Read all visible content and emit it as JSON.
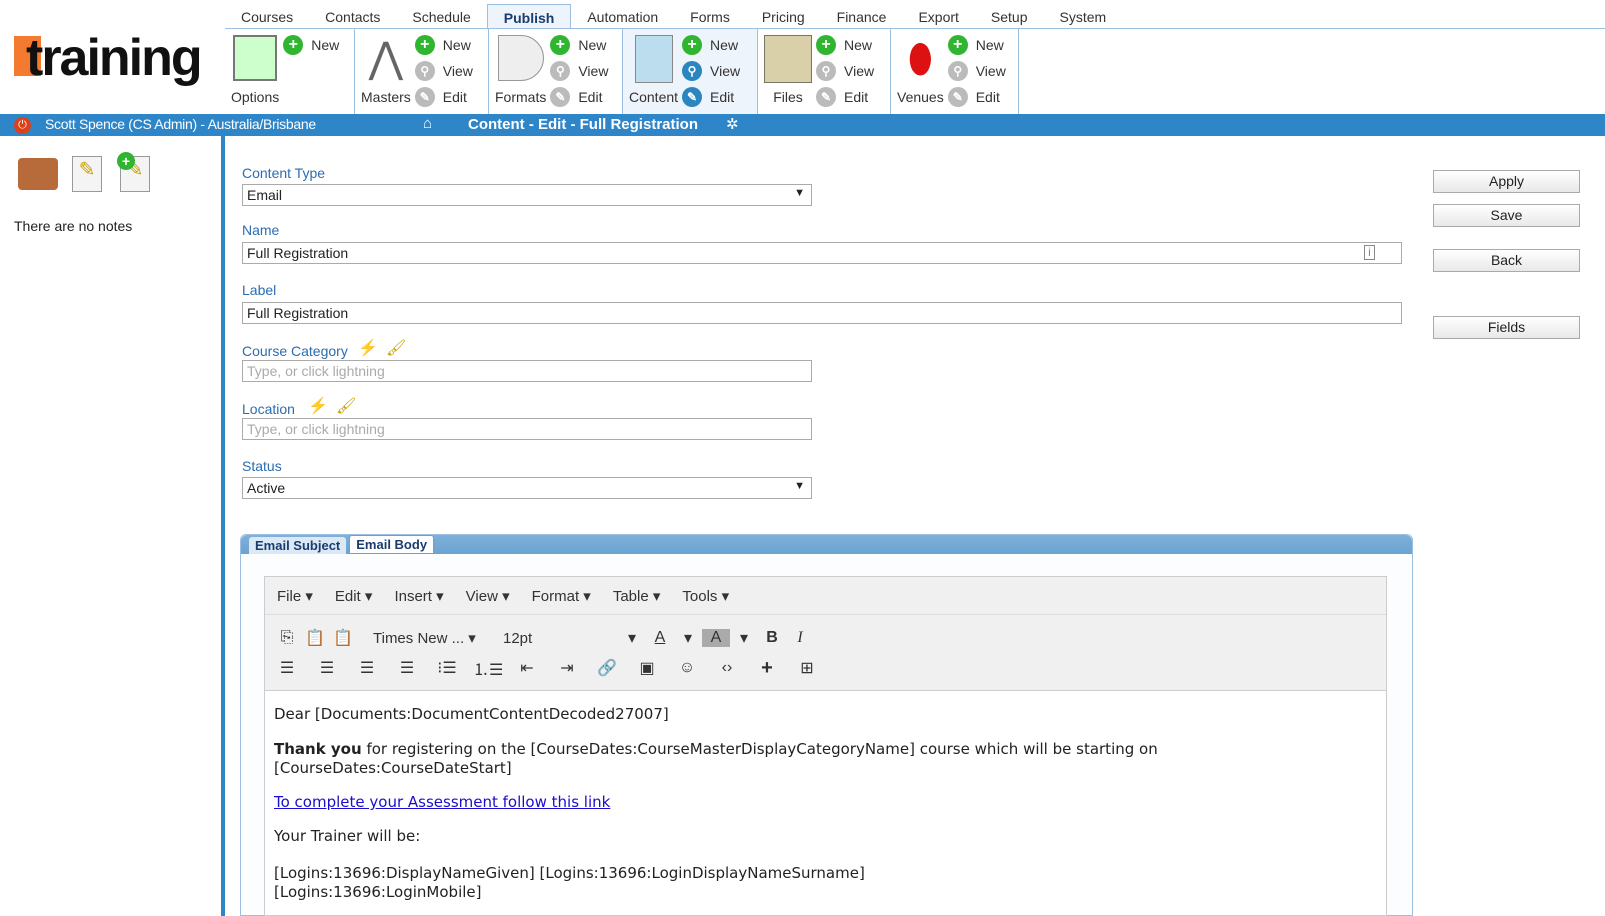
{
  "app": {
    "logo_text": "training",
    "brand_color": "#f47a30",
    "accent": "#2e86c8"
  },
  "top_tabs": [
    "Courses",
    "Contacts",
    "Schedule",
    "Publish",
    "Automation",
    "Forms",
    "Pricing",
    "Finance",
    "Export",
    "Setup",
    "System"
  ],
  "active_tab": "Publish",
  "ribbon": [
    {
      "name": "Options",
      "actions": [
        "New"
      ]
    },
    {
      "name": "Masters",
      "actions": [
        "New",
        "View",
        "Edit"
      ]
    },
    {
      "name": "Formats",
      "actions": [
        "New",
        "View",
        "Edit"
      ]
    },
    {
      "name": "Content",
      "actions": [
        "New",
        "View",
        "Edit"
      ]
    },
    {
      "name": "Files",
      "actions": [
        "New",
        "View",
        "Edit"
      ]
    },
    {
      "name": "Venues",
      "actions": [
        "New",
        "View",
        "Edit"
      ]
    }
  ],
  "status_bar": {
    "user": "Scott Spence (CS Admin) - Australia/Brisbane",
    "title": "Content - Edit - Full Registration"
  },
  "sidebar": {
    "notes": "There are no notes"
  },
  "form": {
    "content_type_label": "Content Type",
    "content_type": "Email",
    "name_label": "Name",
    "name": "Full Registration",
    "label_label": "Label",
    "label": "Full Registration",
    "course_category_label": "Course Category",
    "course_category_placeholder": "Type, or click lightning",
    "location_label": "Location",
    "location_placeholder": "Type, or click lightning",
    "status_label": "Status",
    "status": "Active"
  },
  "buttons": {
    "apply": "Apply",
    "save": "Save",
    "back": "Back",
    "fields": "Fields"
  },
  "editor": {
    "tabs": [
      "Email Subject",
      "Email Body"
    ],
    "menu": [
      "File",
      "Edit",
      "Insert",
      "View",
      "Format",
      "Table",
      "Tools"
    ],
    "font": "Times New ...",
    "size": "12pt",
    "body": {
      "line1": "Dear [Documents:DocumentContentDecoded27007]",
      "bold": "Thank you",
      "line2": " for registering on the [CourseDates:CourseMasterDisplayCategoryName] course which will be starting on [CourseDates:CourseDateStart]",
      "link": "To complete your Assessment follow this link",
      "line3": "Your Trainer will be:",
      "line4": "[Logins:13696:DisplayNameGiven] [Logins:13696:LoginDisplayNameSurname]",
      "line5": "[Logins:13696:LoginMobile]"
    }
  }
}
